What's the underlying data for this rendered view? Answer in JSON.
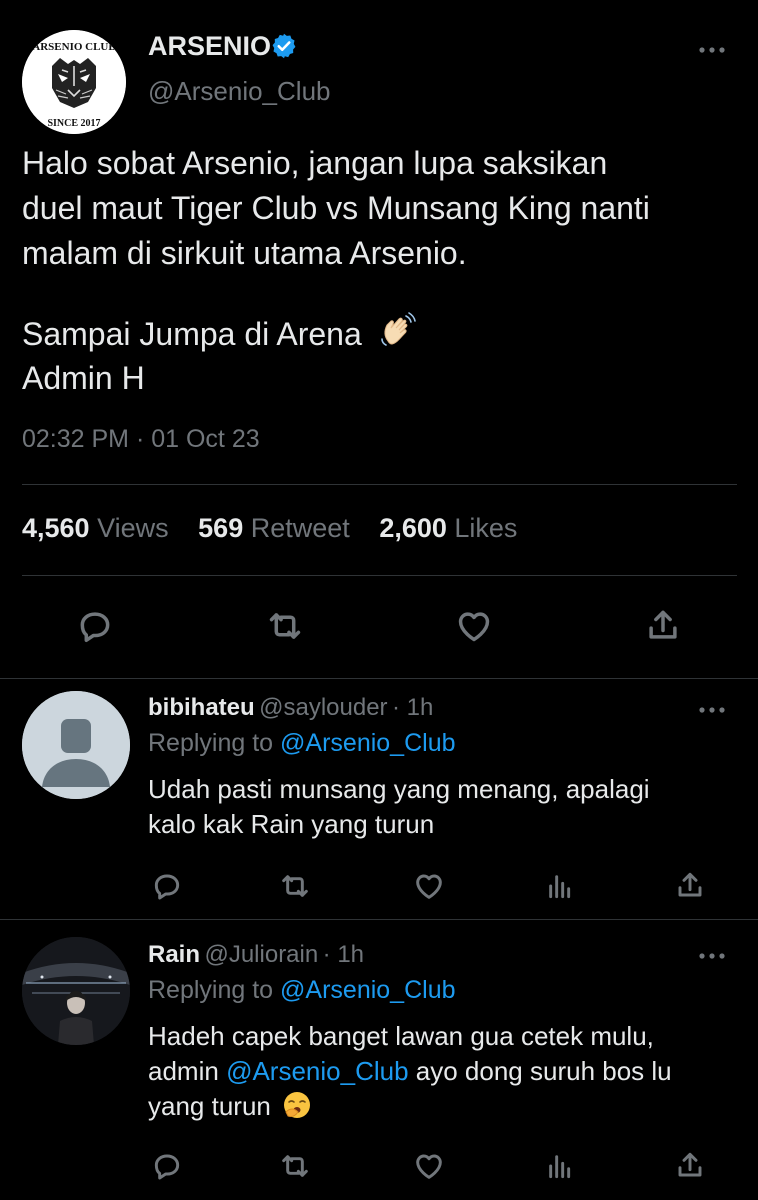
{
  "main_tweet": {
    "logo_text_top": "ARSENIO CLUB",
    "logo_text_bottom": "SINCE 2017",
    "name": "ARSENIO",
    "handle": "@Arsenio_Club",
    "lines": [
      "Halo sobat Arsenio, jangan lupa saksikan",
      "duel maut Tiger Club vs Munsang King nanti",
      "malam di sirkuit utama Arsenio.",
      "Sampai Jumpa di Arena",
      "Admin H"
    ],
    "timestamp": "02:32 PM · 01 Oct 23",
    "stats": {
      "views_count": "4,560",
      "views_label": "Views",
      "retweets_count": "569",
      "retweets_label": "Retweet",
      "likes_count": "2,600",
      "likes_label": "Likes"
    }
  },
  "replies": [
    {
      "name": "bibihateu",
      "handle": "@saylouder",
      "age": "· 1h",
      "replying_prefix": "Replying to",
      "replying_to": "@Arsenio_Club",
      "lines": [
        "Udah pasti munsang yang menang, apalagi",
        "kalo kak Rain yang turun"
      ]
    },
    {
      "name": "Rain",
      "handle": "@Juliorain",
      "age": "· 1h",
      "replying_prefix": "Replying to",
      "replying_to": "@Arsenio_Club",
      "line1": "Hadeh capek banget lawan gua cetek mulu,",
      "line2_prefix": "admin",
      "line2_mention": "@Arsenio_Club",
      "line2_suffix": "ayo dong suruh bos lu",
      "line3": "yang turun"
    }
  ],
  "colors": {
    "background": "#000000",
    "text": "#e7e9ea",
    "muted": "#71767b",
    "link": "#1d9bf0",
    "verified": "#1d9bf0",
    "divider": "#2f3336"
  },
  "icons": [
    "verified-badge-icon",
    "more-icon",
    "reply-icon",
    "retweet-icon",
    "like-icon",
    "share-icon",
    "analytics-icon",
    "waving-hand-emoji",
    "yawning-face-emoji"
  ]
}
